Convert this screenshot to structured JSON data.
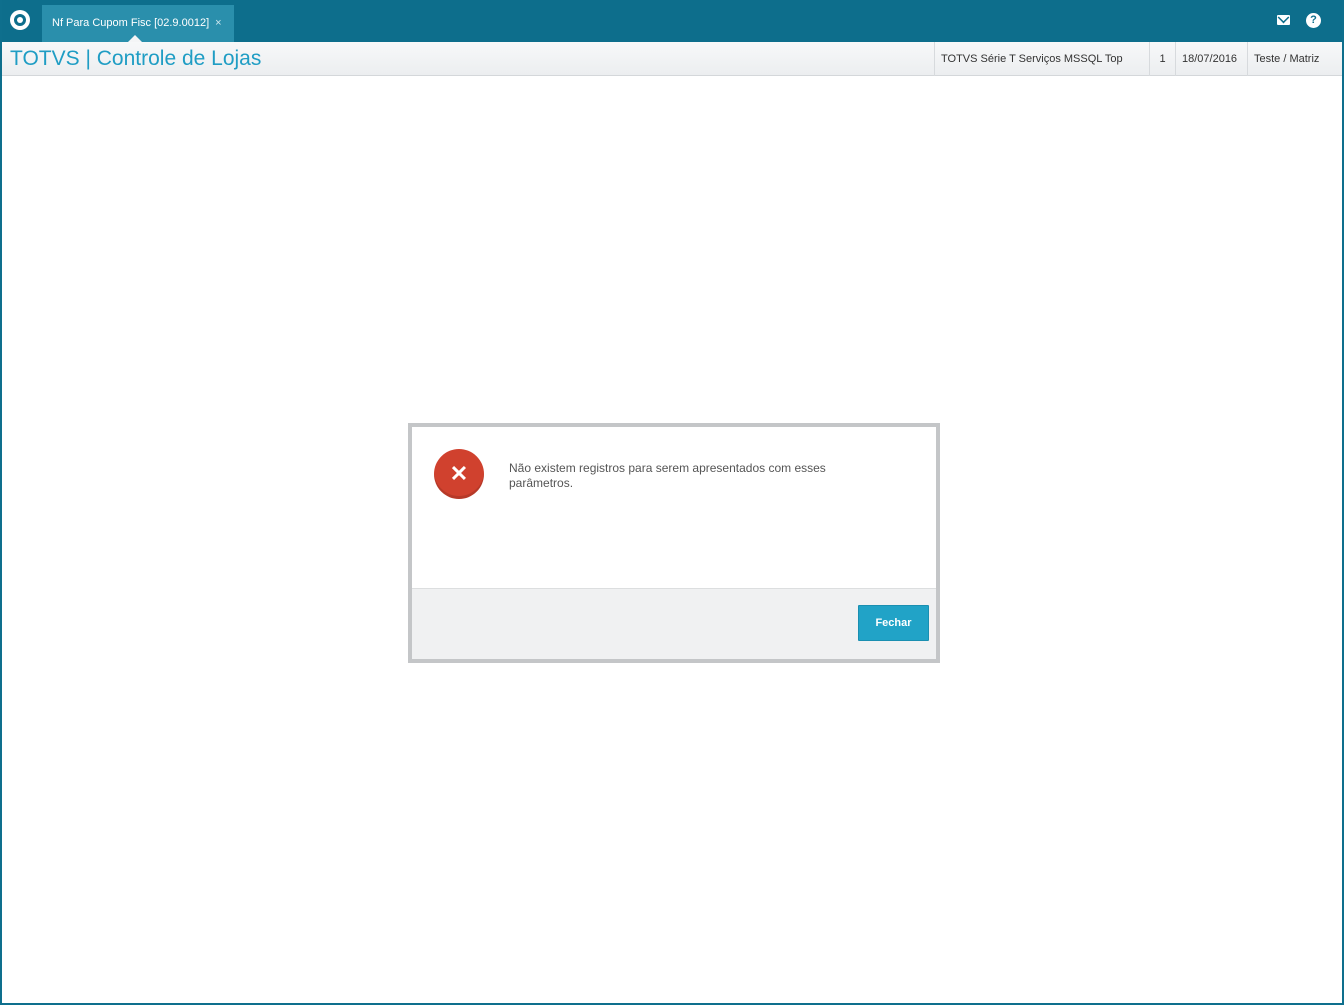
{
  "colors": {
    "topbar": "#0d6e8c",
    "tab": "#2a8fac",
    "title": "#1f9dc4",
    "button": "#21a3c7",
    "error": "#d0412e"
  },
  "topbar": {
    "logo_icon": "totvs-logo-icon",
    "tab": {
      "label": "Nf Para Cupom Fisc [02.9.0012]",
      "close": "×"
    },
    "mail_icon": "mail-icon",
    "help_icon": "help-icon",
    "help_glyph": "?"
  },
  "header": {
    "title": "TOTVS | Controle de Lojas",
    "environment": "TOTVS Série T Serviços MSSQL Top",
    "number": "1",
    "date": "18/07/2016",
    "user": "Teste / Matriz"
  },
  "dialog": {
    "icon": "error-icon",
    "icon_glyph": "✕",
    "message": "Não existem registros para serem apresentados com esses parâmetros.",
    "button": "Fechar"
  }
}
